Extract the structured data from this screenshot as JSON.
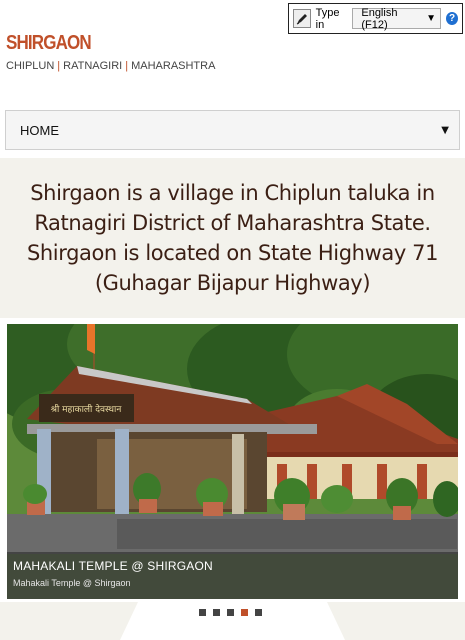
{
  "typein": {
    "label": "Type in",
    "language": "English (F12)",
    "help": "?"
  },
  "site": {
    "title": "SHIRGAON",
    "subtitle": [
      "CHIPLUN",
      "RATNAGIRI",
      "MAHARASHTRA"
    ]
  },
  "nav": {
    "current": "HOME"
  },
  "intro": {
    "text": "Shirgaon is a village in Chiplun taluka in Ratnagiri District of Maharashtra State. Shirgaon is located on State Highway 71 (Guhagar Bijapur Highway)"
  },
  "slide": {
    "title": "MAHAKALI TEMPLE @ SHIRGAON",
    "subtitle": "Mahakali Temple @ Shirgaon",
    "temple_sign": "श्री महाकाली देवस्थान"
  },
  "slider_dots": {
    "count": 5,
    "active_index": 3
  },
  "colors": {
    "brand": "#c0502a",
    "intro_text": "#3b1f14",
    "band_bg": "#f3f2ec"
  }
}
